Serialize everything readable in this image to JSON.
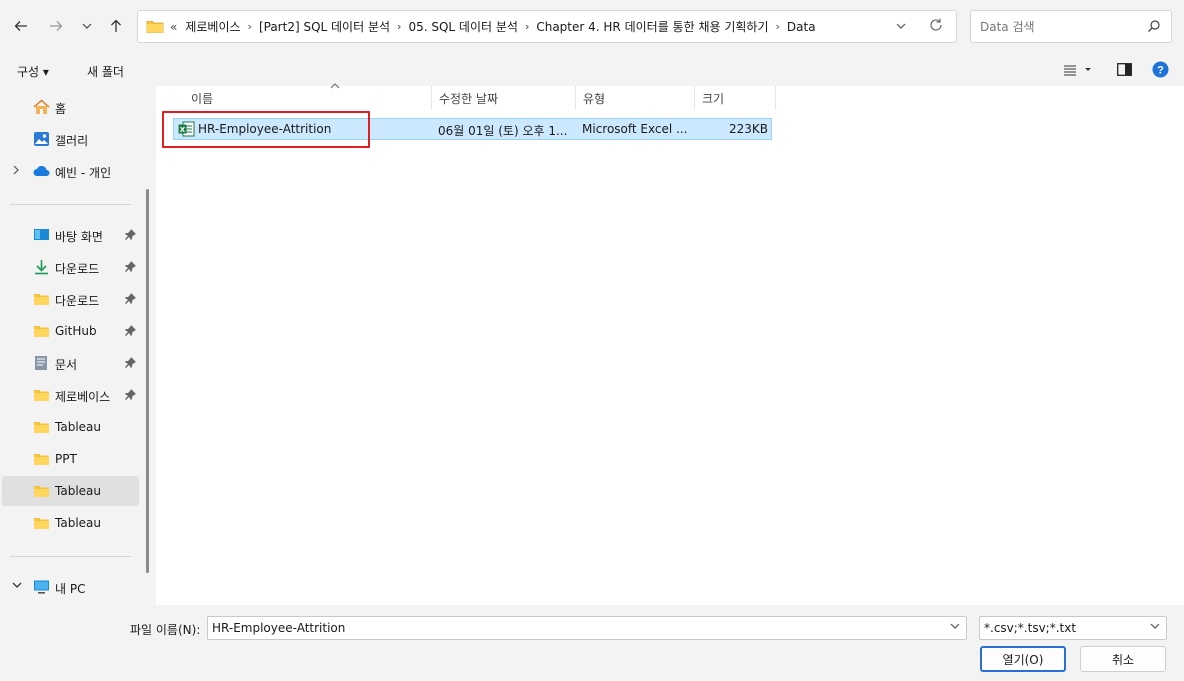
{
  "address": {
    "overflow": "«",
    "segments": [
      "제로베이스",
      "[Part2] SQL 데이터 분석",
      "05. SQL 데이터 분석",
      "Chapter 4. HR 데이터를 통한 채용 기획하기",
      "Data"
    ]
  },
  "search": {
    "placeholder": "Data 검색"
  },
  "toolbar": {
    "organize": "구성 ▾",
    "new_folder": "새 폴더"
  },
  "sidebar": {
    "top_items": [
      {
        "label": "홈",
        "icon": "home-icon"
      },
      {
        "label": "갤러리",
        "icon": "gallery-icon"
      },
      {
        "label": "예빈 - 개인",
        "icon": "onedrive-cloud-icon"
      }
    ],
    "pinned_items": [
      {
        "label": "바탕 화면",
        "icon": "desktop-icon"
      },
      {
        "label": "다운로드",
        "icon": "download-arrow-icon"
      },
      {
        "label": "다운로드",
        "icon": "folder-icon"
      },
      {
        "label": "GitHub",
        "icon": "folder-icon"
      },
      {
        "label": "문서",
        "icon": "documents-icon"
      },
      {
        "label": "제로베이스",
        "icon": "folder-icon"
      },
      {
        "label": "Tableau",
        "icon": "folder-icon"
      },
      {
        "label": "PPT",
        "icon": "folder-icon"
      },
      {
        "label": "Tableau",
        "icon": "folder-icon"
      },
      {
        "label": "Tableau",
        "icon": "folder-icon"
      }
    ],
    "this_pc": "내 PC"
  },
  "columns": {
    "name": "이름",
    "modified": "수정한 날짜",
    "type": "유형",
    "size": "크기"
  },
  "files": [
    {
      "name": "HR-Employee-Attrition",
      "modified": "06월 01일 (토) 오후 1...",
      "type": "Microsoft Excel ...",
      "size": "223KB"
    }
  ],
  "bottom": {
    "filename_label": "파일 이름(N):",
    "filename_value": "HR-Employee-Attrition",
    "filetype": "*.csv;*.tsv;*.txt",
    "open_label": "열기(O)",
    "cancel_label": "취소"
  },
  "colors": {
    "selection_bg": "#cce8ff",
    "selection_border": "#99d1ff",
    "highlight": "#e02020",
    "accent": "#2a6fd6"
  }
}
